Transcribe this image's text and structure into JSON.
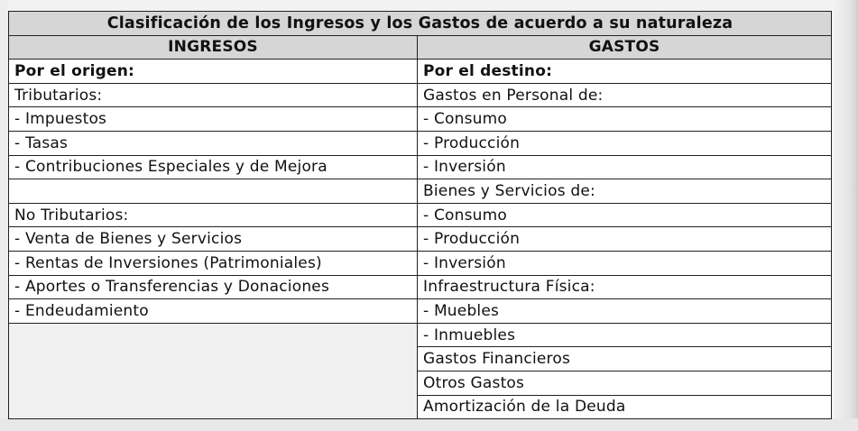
{
  "title": "Clasificación de los Ingresos y los Gastos de acuerdo a su naturaleza",
  "headers": {
    "ingresos": "INGRESOS",
    "gastos": "GASTOS"
  },
  "rows": [
    {
      "left": "Por el origen:",
      "right": "Por el destino:"
    },
    {
      "left": "Tributarios:",
      "right": "Gastos en Personal de:"
    },
    {
      "left": "- Impuestos",
      "right": "- Consumo"
    },
    {
      "left": "- Tasas",
      "right": "- Producción"
    },
    {
      "left": "- Contribuciones Especiales y de Mejora",
      "right": "- Inversión"
    },
    {
      "left": "",
      "right": "Bienes y Servicios de:"
    },
    {
      "left": "No Tributarios:",
      "right": "- Consumo"
    },
    {
      "left": "- Venta de Bienes y Servicios",
      "right": "- Producción"
    },
    {
      "left": "- Rentas de Inversiones (Patrimoniales)",
      "right": "- Inversión"
    },
    {
      "left": "- Aportes o Transferencias y Donaciones",
      "right": "Infraestructura Física:"
    },
    {
      "left": "- Endeudamiento",
      "right": "- Muebles"
    },
    {
      "left": "",
      "right": "- Inmuebles"
    },
    {
      "left": "",
      "right": "Gastos Financieros"
    },
    {
      "left": "",
      "right": "Otros Gastos"
    },
    {
      "left": "",
      "right": "Amortización de la Deuda"
    }
  ]
}
